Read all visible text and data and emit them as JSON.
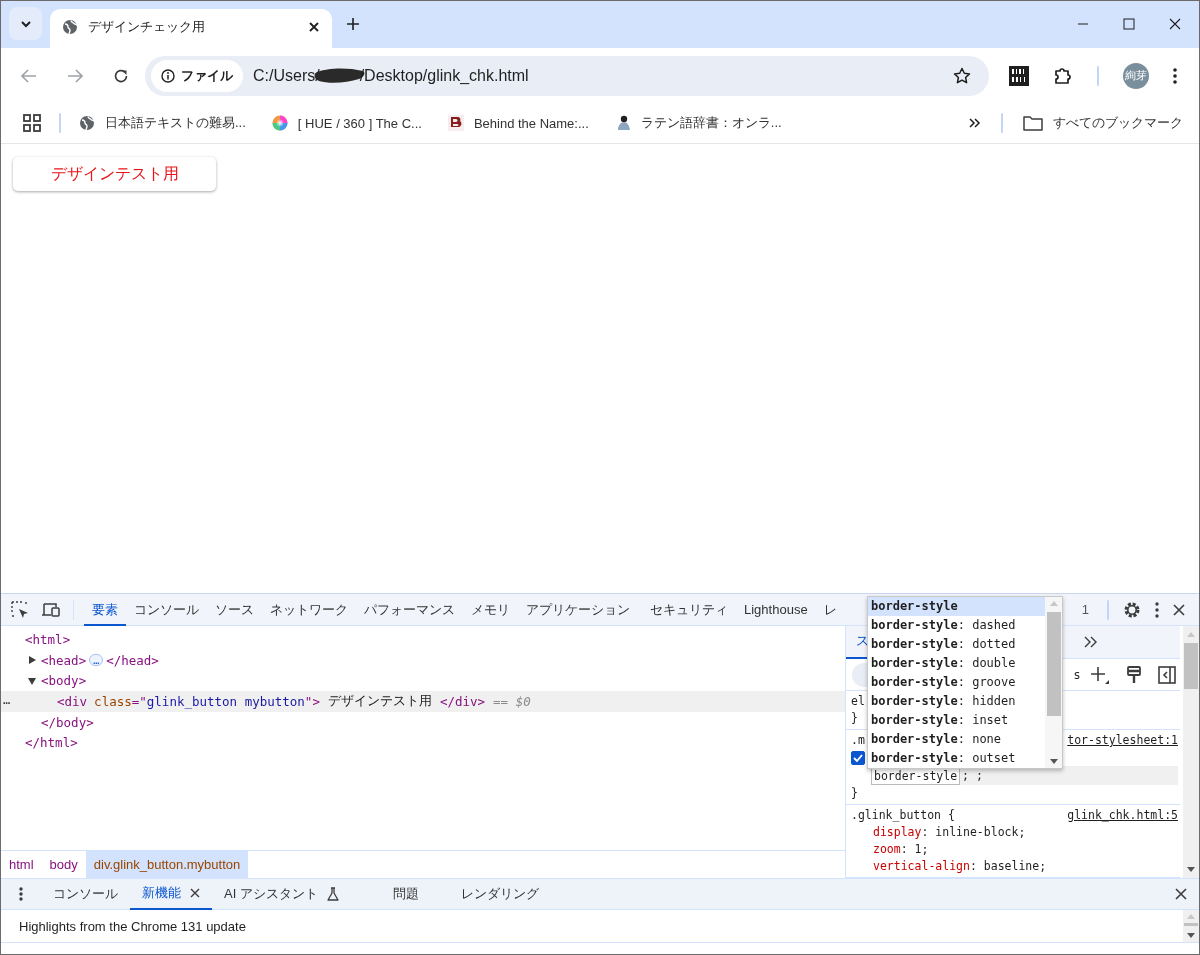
{
  "browser": {
    "tabs": [
      {
        "title": "デザインチェック用",
        "selected": true
      }
    ],
    "toolbar": {
      "security_chip": "ファイル",
      "url_start": "C:/Users/",
      "url_end": "/Desktop/glink_chk.html",
      "profile": "絢芽"
    },
    "bookmarks": [
      {
        "title": "日本語テキストの難易...",
        "kind": "globe"
      },
      {
        "title": "[ HUE / 360 ] The C...",
        "kind": "wheel"
      },
      {
        "title": "Behind the Name:...",
        "kind": "letter"
      },
      {
        "title": "ラテン語辞書：オンラ...",
        "kind": "figure"
      }
    ],
    "all_bookmarks": "すべてのブックマーク"
  },
  "page": {
    "button": "デザインテスト用"
  },
  "devtools": {
    "tabs": [
      {
        "label": "要素",
        "selected": true
      },
      {
        "label": "コンソール",
        "selected": false
      },
      {
        "label": "ソース",
        "selected": false
      },
      {
        "label": "ネットワーク",
        "selected": false
      },
      {
        "label": "パフォーマンス",
        "selected": false
      },
      {
        "label": "メモリ",
        "selected": false
      },
      {
        "label": "アプリケーション",
        "selected": false
      },
      {
        "label": "セキュリティ",
        "selected": false
      },
      {
        "label": "Lighthouse",
        "selected": false
      },
      {
        "label": "レ",
        "selected": false
      }
    ],
    "issue_count": "1",
    "dom": [
      {
        "open": "<html>",
        "close": "</html>",
        "children": [
          {
            "open": "<head>",
            "close": "</head>",
            "expanded": false,
            "ellipsis": "…"
          },
          {
            "open": "<body>",
            "close": "</body>",
            "expanded": true,
            "children": [
              {
                "selected": true,
                "row_marker": "…",
                "tokens": [
                  {
                    "kind": "tag",
                    "text": "<div"
                  },
                  {
                    "kind": "attr",
                    "text": "class"
                  },
                  {
                    "kind": "tag",
                    "text": "=\""
                  },
                  {
                    "kind": "value",
                    "text": "glink_button mybutton"
                  },
                  {
                    "kind": "tag",
                    "text": "\">"
                  },
                  {
                    "kind": "text",
                    "text": "デザインテスト用"
                  },
                  {
                    "kind": "tag",
                    "text": "</div>"
                  },
                  {
                    "kind": "note",
                    "text": "== $0"
                  }
                ]
              }
            ]
          }
        ]
      }
    ],
    "breadcrumbs": [
      {
        "label": "html",
        "selected": false
      },
      {
        "label": "body",
        "selected": false
      },
      {
        "label": "div.glink_button.mybutton",
        "selected": true
      }
    ],
    "styles": {
      "subtab": "ス",
      "filter": "s",
      "rules": [
        {
          "selector": "el",
          "close": "}"
        },
        {
          "selector": ".m",
          "source": "tor-stylesheet:1",
          "checked": true,
          "editing": "border-style",
          "after": "; ;",
          "close": "}"
        },
        {
          "selector": ".glink_button {",
          "source": "glink_chk.html:5",
          "declarations": [
            {
              "property": "display",
              "value": ": inline-block;"
            },
            {
              "property": "zoom",
              "value": ": 1;"
            },
            {
              "property": "vertical-align",
              "value": ": baseline;"
            }
          ]
        }
      ]
    },
    "autocomplete": [
      {
        "name": "border-style",
        "selected": true
      },
      {
        "name": "border-style",
        "value": ": dashed",
        "selected": false
      },
      {
        "name": "border-style",
        "value": ": dotted",
        "selected": false
      },
      {
        "name": "border-style",
        "value": ": double",
        "selected": false
      },
      {
        "name": "border-style",
        "value": ": groove",
        "selected": false
      },
      {
        "name": "border-style",
        "value": ": hidden",
        "selected": false
      },
      {
        "name": "border-style",
        "value": ": inset",
        "selected": false
      },
      {
        "name": "border-style",
        "value": ": none",
        "selected": false
      },
      {
        "name": "border-style",
        "value": ": outset",
        "selected": false
      }
    ],
    "drawer": {
      "tabs": [
        {
          "label": "コンソール",
          "selected": false
        },
        {
          "label": "新機能",
          "selected": true,
          "closable": true
        },
        {
          "label": "AI アシスタント",
          "selected": false,
          "experimental": true
        },
        {
          "label": "問題",
          "selected": false
        },
        {
          "label": "レンダリング",
          "selected": false
        }
      ],
      "content": "Highlights from the Chrome 131 update"
    }
  }
}
